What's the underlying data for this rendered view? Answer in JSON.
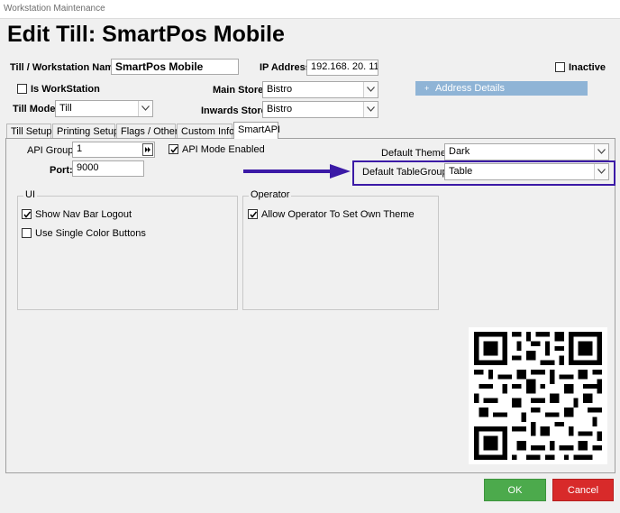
{
  "window": {
    "title": "Workstation Maintenance"
  },
  "heading": "Edit Till: SmartPos Mobile",
  "form": {
    "name_label": "Till / Workstation Name:",
    "name_value": "SmartPos Mobile",
    "ip_label": "IP Address:",
    "ip_value": "192.168. 20. 11",
    "inactive_label": "Inactive",
    "is_workstation_label": "Is WorkStation",
    "till_mode_label": "Till Mode:",
    "till_mode_value": "Till",
    "main_store_label": "Main Store:",
    "main_store_value": "Bistro",
    "inwards_store_label": "Inwards Store:",
    "inwards_store_value": "Bistro",
    "address_details_label": "Address Details"
  },
  "tabs": [
    {
      "label": "Till Setup"
    },
    {
      "label": "Printing Setup"
    },
    {
      "label": "Flags / Other"
    },
    {
      "label": "Custom Info"
    },
    {
      "label": "SmartAPI"
    }
  ],
  "smartapi": {
    "api_group_label": "API Group:",
    "api_group_value": "1",
    "api_mode_label": "API Mode Enabled",
    "port_label": "Port:",
    "port_value": "9000",
    "default_theme_label": "Default Theme:",
    "default_theme_value": "Dark",
    "default_tablegroup_label": "Default TableGroup:",
    "default_tablegroup_value": "Table",
    "ui_group": {
      "legend": "UI",
      "show_nav_label": "Show Nav Bar Logout",
      "single_color_label": "Use Single Color Buttons"
    },
    "operator_group": {
      "legend": "Operator",
      "allow_theme_label": "Allow Operator To Set Own Theme"
    }
  },
  "buttons": {
    "ok": "OK",
    "cancel": "Cancel"
  },
  "colors": {
    "ok": "#4caa4c",
    "cancel": "#d82a2a",
    "arrow": "#3b1aa6",
    "address_bar": "#8fb4d6"
  }
}
